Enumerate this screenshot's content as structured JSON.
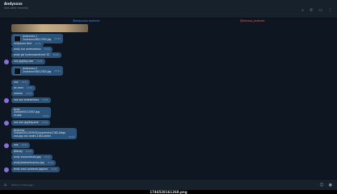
{
  "header": {
    "title": "Andyxxxx",
    "status": "last seen recently",
    "icons": [
      "search-icon",
      "phone-icon",
      "sidebar-icon",
      "more-icon"
    ]
  },
  "tags": {
    "left": "@andyxxxx andrsmt",
    "right": "@alexxxx_andrsmt"
  },
  "messages": [
    {
      "type": "file",
      "text": "Andyxxxx.1\n2xxxxxxx38/12302.jpg",
      "time": "13:21"
    },
    {
      "type": "text",
      "text": "andyxxxx text",
      "time": "13:21"
    },
    {
      "type": "text",
      "text": "andy xxx andrsmtxxx",
      "time": "13:21"
    },
    {
      "type": "text",
      "text": "andy gsi hydrxxxandrsmt 33",
      "time": "13:21"
    },
    {
      "type": "avatar",
      "text": "xxx jpg/big-size",
      "time": "13:21"
    },
    {
      "type": "file",
      "text": "Andyxxxx.2\n2xxxxxxx38/12302.jpg",
      "time": "13:21"
    },
    {
      "type": "text",
      "text": "xxx",
      "time": "13:21"
    },
    {
      "type": "text",
      "text": "ax xxxx",
      "time": "13:21"
    },
    {
      "type": "text",
      "text": "xxxxxx",
      "time": "13:21"
    },
    {
      "type": "avatar",
      "text": "xxx sxx andrsmtxxx",
      "time": "13:21"
    },
    {
      "type": "text",
      "text": "Andy\n2xxxx000/12302.jpg\nxx.jpg",
      "time": "13:21"
    },
    {
      "type": "avatar",
      "text": "xxx xxx jpg/big-size",
      "time": "13:21"
    },
    {
      "type": "text",
      "text": "Andyxxx\n2xxxxx20/120303/2xxx/andrs/2182.Adgo\nxxx.jpg xxx andrs 2182.andrs",
      "time": "13:21"
    },
    {
      "type": "avatar",
      "text": "xxx",
      "time": "13:21"
    },
    {
      "type": "text",
      "text": "ATandy",
      "time": "13:21"
    },
    {
      "type": "text",
      "text": "andy xxx/andrsdx.jpg",
      "time": "13:21"
    },
    {
      "type": "text",
      "text": "andy/andrsmtxx/xxx.jpg",
      "time": "13:21"
    },
    {
      "type": "avatar",
      "text": "andy xxxx andrsmt.jpg/xxx",
      "time": "13:21"
    }
  ],
  "composer": {
    "placeholder": "Write a message...",
    "left_icon": "attach-icon",
    "right_icons": [
      "sticker-icon",
      "mic-icon"
    ]
  },
  "caption": "1746528161268.png",
  "colors": {
    "background": "#0e1621",
    "bubble": "#2b5278",
    "header": "#17212b",
    "tag_left": "#4a93ff",
    "tag_right": "#ff5b5b",
    "avatar": "#8a6ee0"
  }
}
